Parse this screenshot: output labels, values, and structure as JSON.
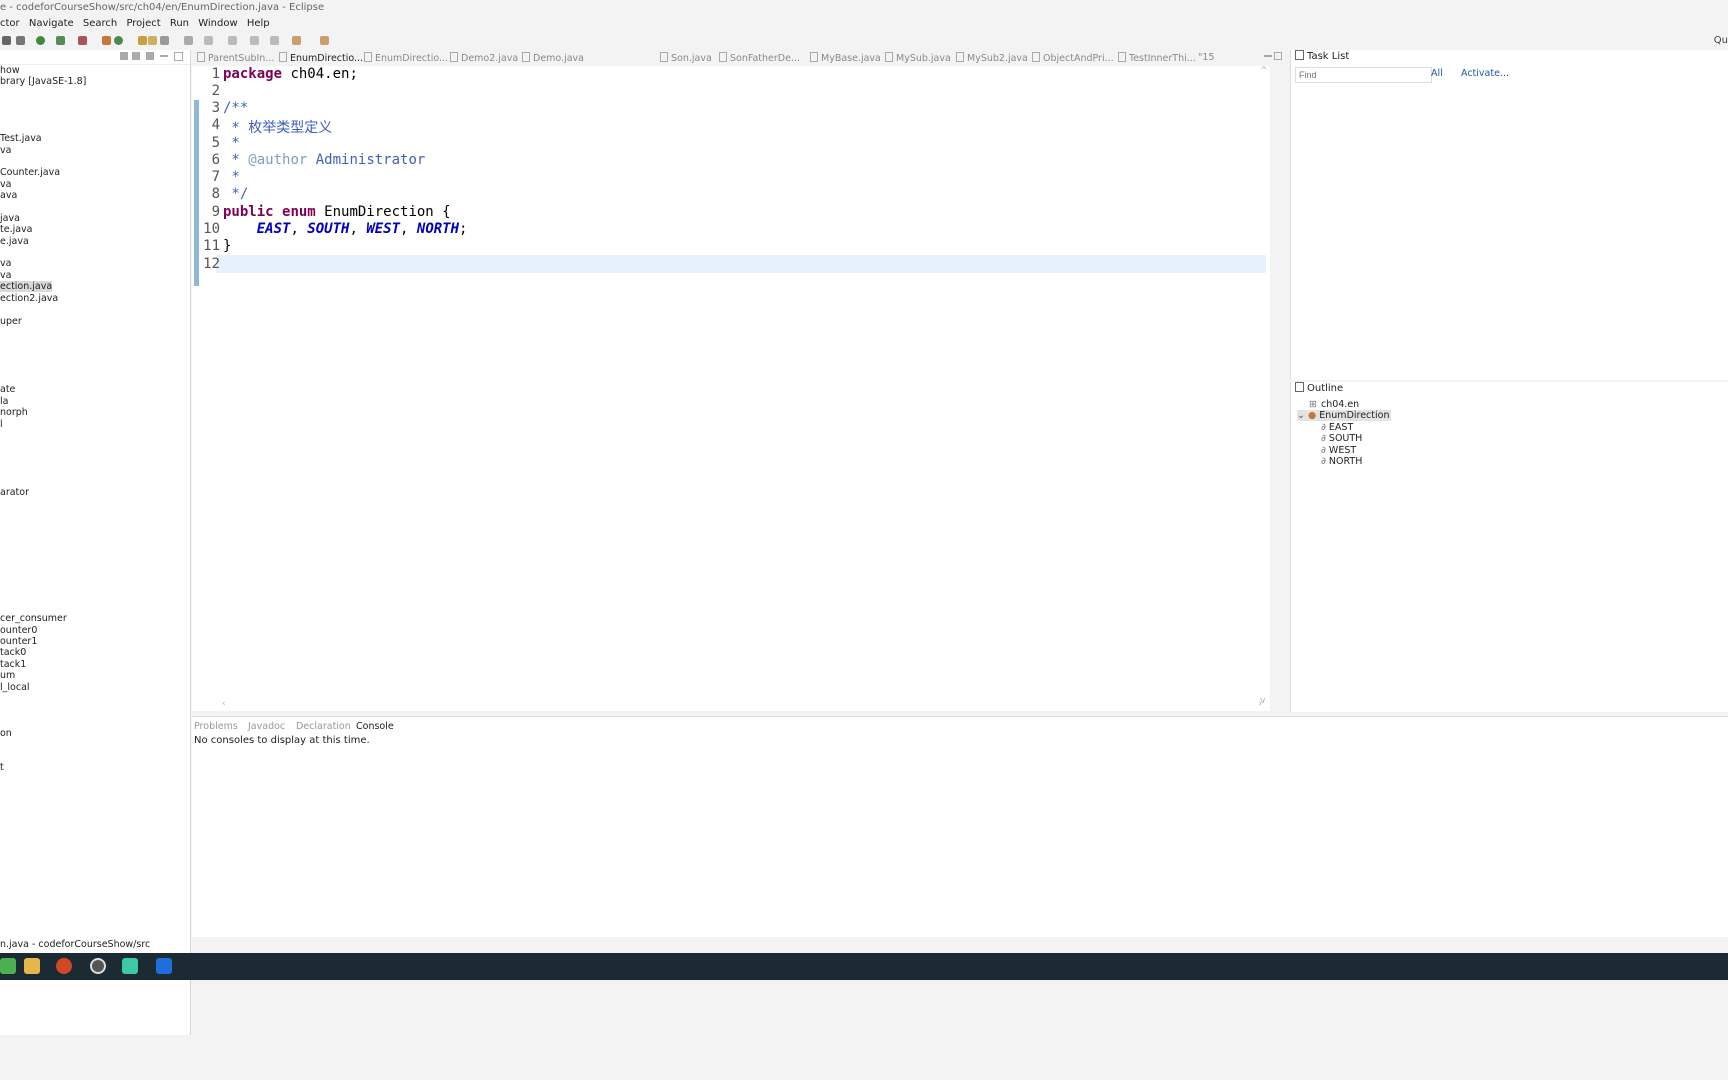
{
  "window": {
    "title": "e - codeforCourseShow/src/ch04/en/EnumDirection.java - Eclipse"
  },
  "menu": [
    "ctor",
    "Navigate",
    "Search",
    "Project",
    "Run",
    "Window",
    "Help"
  ],
  "quick_access": "Qu",
  "explorer": {
    "rows": [
      "how",
      "brary [JavaSE-1.8]",
      "Test.java",
      "va",
      "Counter.java",
      "va",
      "ava",
      "java",
      "te.java",
      "e.java",
      "va",
      "va",
      "ection.java",
      "ection2.java",
      "uper",
      "ate",
      "la",
      "norph",
      "l",
      "arator",
      "cer_consumer",
      "ounter0",
      "ounter1",
      "tack0",
      "tack1",
      "um",
      "l_local",
      "on",
      "t"
    ]
  },
  "tabs": [
    "ParentSubIn...",
    "EnumDirectio...",
    "EnumDirectio...",
    "Demo2.java",
    "Demo.java",
    "Son.java",
    "SonFatherDe...",
    "MyBase.java",
    "MySub.java",
    "MySub2.java",
    "ObjectAndPri...",
    "TestInnerThi...",
    "\"15"
  ],
  "editor": {
    "line_numbers": [
      "1",
      "2",
      "3",
      "4",
      "5",
      "6",
      "7",
      "8",
      "9",
      "10",
      "11",
      "12"
    ],
    "lines": {
      "l1_kw": "package",
      "l1_rest": " ch04.en;",
      "l3": "/**",
      "l4": " * 枚举类型定义",
      "l5": " *",
      "l6_a": " * ",
      "l6_tag": "@author",
      "l6_b": " Administrator",
      "l7": " *",
      "l8": " */",
      "l9_kw1": "public",
      "l9_kw2": "enum",
      "l9_rest": " EnumDirection {",
      "l10_pre": "    ",
      "l10_e1": "EAST",
      "l10_s1": ", ",
      "l10_e2": "SOUTH",
      "l10_s2": ", ",
      "l10_e3": "WEST",
      "l10_s3": ", ",
      "l10_e4": "NORTH",
      "l10_end": ";",
      "l11": "}"
    }
  },
  "tasklist": {
    "title": "Task List",
    "find_placeholder": "Find",
    "all": "All",
    "activate": "Activate..."
  },
  "outline": {
    "title": "Outline",
    "package": "ch04.en",
    "type": "EnumDirection",
    "constants": [
      "EAST",
      "SOUTH",
      "WEST",
      "NORTH"
    ]
  },
  "console": {
    "tabs": [
      "Problems",
      "Javadoc",
      "Declaration",
      "Console"
    ],
    "message": "No consoles to display at this time."
  },
  "statusbar": {
    "text": "n.java - codeforCourseShow/src"
  },
  "colors": {
    "keyword": "#7f0055",
    "comment": "#3f5fbf",
    "enum_const": "#0000c0",
    "taskbar": "#1b2a33"
  }
}
